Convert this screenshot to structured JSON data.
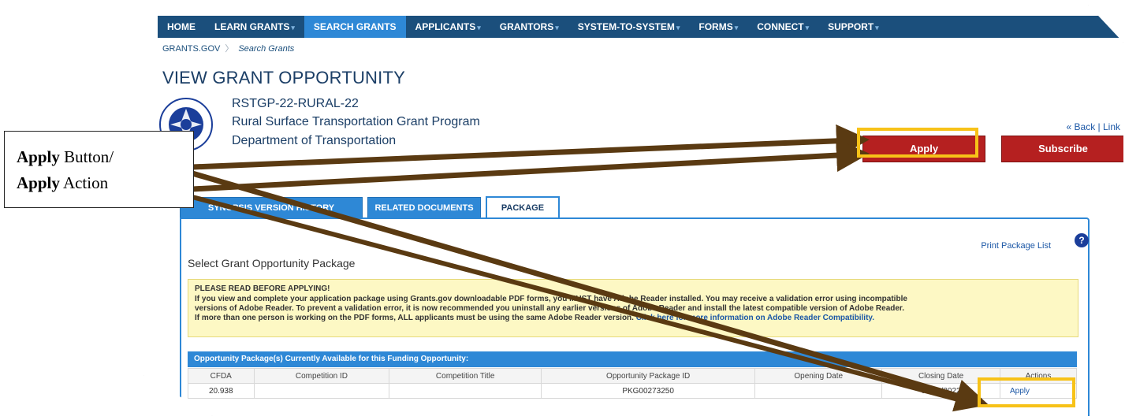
{
  "nav": {
    "items": [
      {
        "label": "HOME",
        "caret": false,
        "active": false
      },
      {
        "label": "LEARN GRANTS",
        "caret": true,
        "active": false
      },
      {
        "label": "SEARCH GRANTS",
        "caret": false,
        "active": true
      },
      {
        "label": "APPLICANTS",
        "caret": true,
        "active": false
      },
      {
        "label": "GRANTORS",
        "caret": true,
        "active": false
      },
      {
        "label": "SYSTEM-TO-SYSTEM",
        "caret": true,
        "active": false
      },
      {
        "label": "FORMS",
        "caret": true,
        "active": false
      },
      {
        "label": "CONNECT",
        "caret": true,
        "active": false
      },
      {
        "label": "SUPPORT",
        "caret": true,
        "active": false
      }
    ]
  },
  "breadcrumb": {
    "home": "GRANTS.GOV",
    "current": "Search Grants"
  },
  "page_title": "VIEW GRANT OPPORTUNITY",
  "opportunity": {
    "number": "RSTGP-22-RURAL-22",
    "title": "Rural Surface Transportation Grant Program",
    "agency": "Department of Transportation"
  },
  "links": {
    "back_link": "« Back | Link"
  },
  "buttons": {
    "apply": "Apply",
    "subscribe": "Subscribe"
  },
  "tabs": {
    "history": "SYNOPSIS VERSION HISTORY",
    "related": "RELATED DOCUMENTS",
    "package": "PACKAGE"
  },
  "package": {
    "print_link": "Print Package List",
    "help": "?",
    "heading": "Select Grant Opportunity Package",
    "notice": {
      "title": "PLEASE READ BEFORE APPLYING!",
      "line1": "If you view and complete your application package using Grants.gov downloadable PDF forms, you MUST have Adobe Reader installed. You may receive a validation error using incompatible",
      "line2": "versions of Adobe Reader. To prevent a validation error, it is now recommended you uninstall any earlier versions of Adobe Reader and install the latest compatible version of Adobe Reader.",
      "line3": "If more than one person is working on the PDF forms, ALL applicants must be using the same Adobe Reader version.",
      "link": "Click here for more information on Adobe Reader Compatibility."
    },
    "table_title": "Opportunity Package(s) Currently Available for this Funding Opportunity:",
    "columns": [
      "CFDA",
      "Competition ID",
      "Competition Title",
      "Opportunity Package ID",
      "Opening Date",
      "Closing Date",
      "Actions"
    ],
    "rows": [
      {
        "cfda": "20.938",
        "competition_id": "",
        "competition_title": "",
        "package_id": "PKG00273250",
        "opening_date": "",
        "closing_date": "05/23/2022",
        "action": "Apply"
      }
    ]
  },
  "callout": {
    "line1_bold": "Apply",
    "line1_rest": " Button/",
    "line2_bold": "Apply",
    "line2_rest": " Action"
  },
  "colors": {
    "nav": "#1b4f7c",
    "active_tab": "#2e88d6",
    "apply_red": "#b52020",
    "highlight": "#f7c218",
    "arrow": "#5a3a12"
  },
  "icons": {
    "agency_logo": "dot-seal-icon",
    "help": "question-circle-icon"
  }
}
